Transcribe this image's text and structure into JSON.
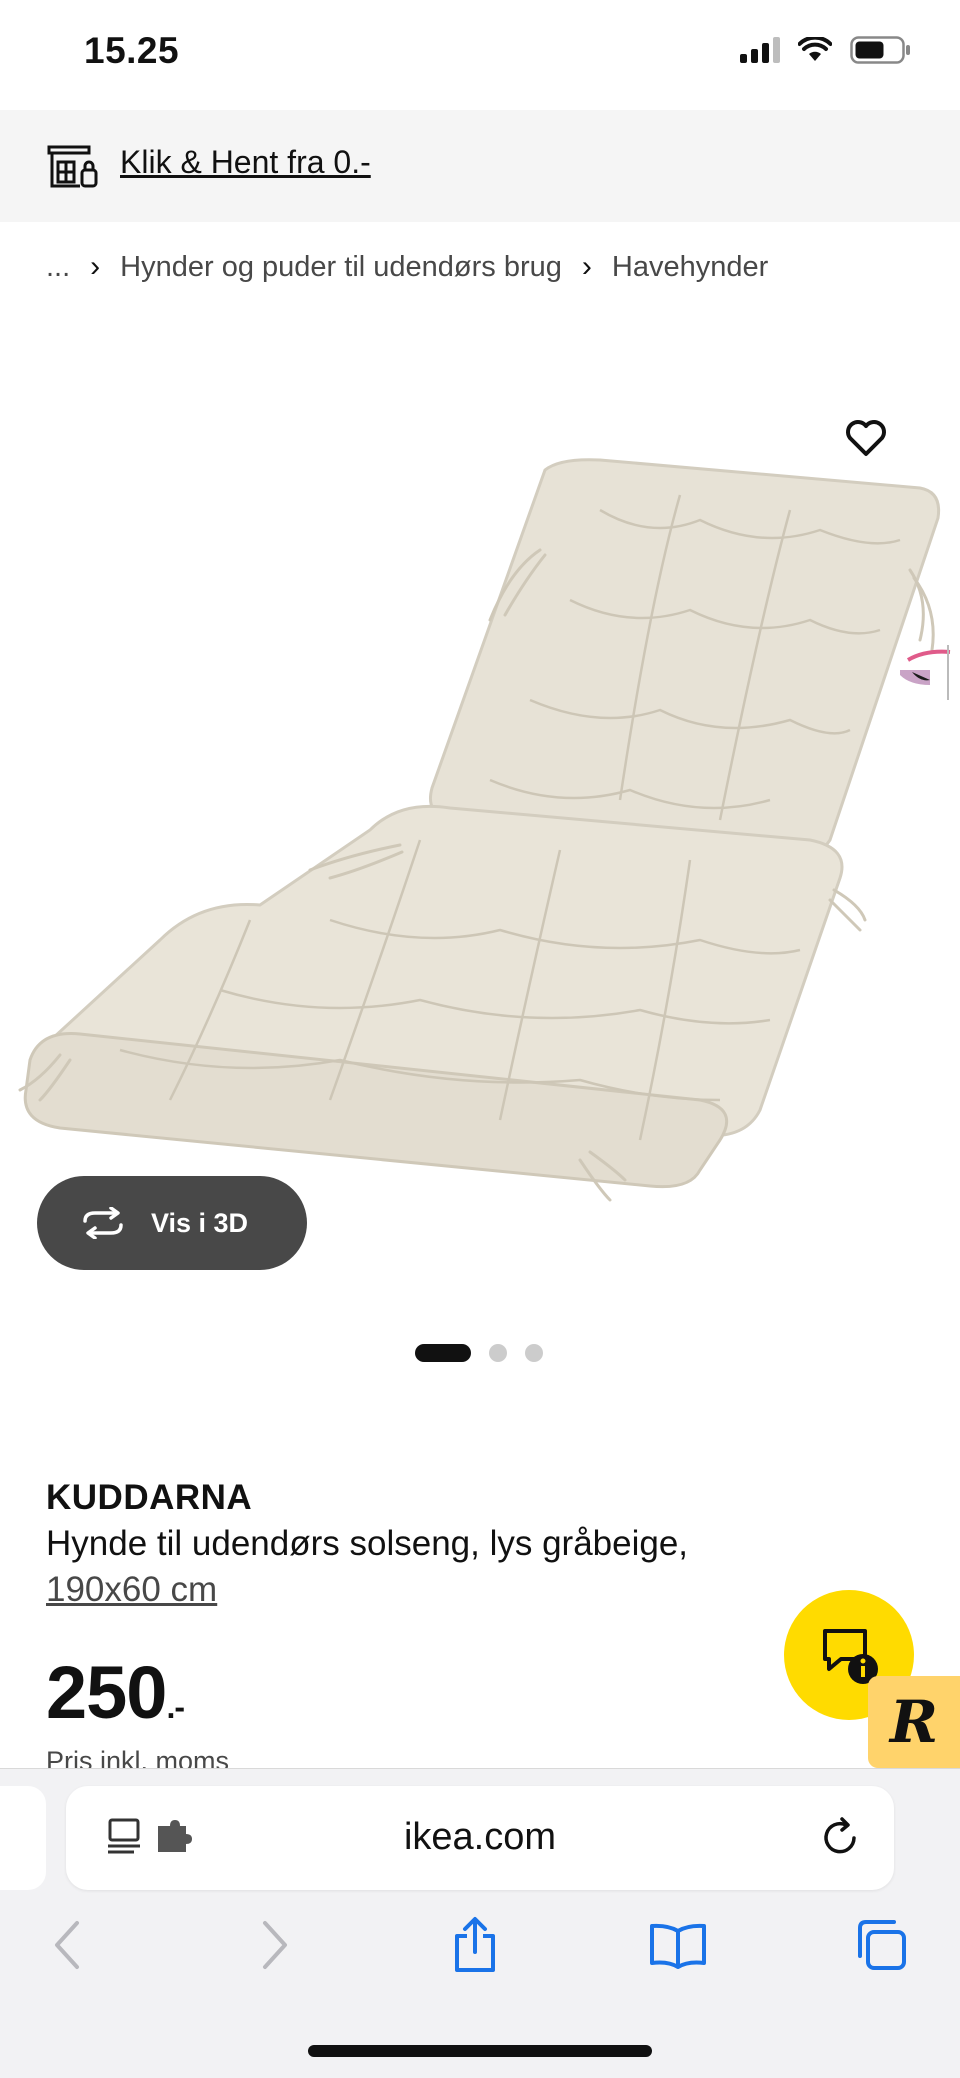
{
  "status_bar": {
    "time": "15.25"
  },
  "promo": {
    "icon": "store-pickup-icon",
    "link_text": "Klik & Hent fra 0.-"
  },
  "breadcrumb": {
    "items": [
      "...",
      "Hynder og puder til udendørs brug",
      "Havehynder"
    ],
    "separator_icon": "chevron-right-icon"
  },
  "gallery": {
    "favorite_icon": "heart-icon",
    "view_3d_label": "Vis i 3D",
    "view_3d_icon": "rotate-3d-icon",
    "slide_count": 3,
    "active_slide": 1
  },
  "product": {
    "name": "KUDDARNA",
    "description": "Hynde til udendørs solseng, lys gråbeige,",
    "size": "190x60 cm",
    "price": "250",
    "price_suffix": ".-",
    "price_note": "Pris inkl. moms"
  },
  "chat": {
    "icon": "chat-info-icon",
    "badge_letter": "R"
  },
  "browser": {
    "url": "ikea.com",
    "reader_icon": "reader-mode-icon",
    "extension_icon": "puzzle-extension-icon",
    "reload_icon": "reload-icon",
    "toolbar": [
      "back-icon",
      "forward-icon",
      "share-icon",
      "bookmarks-icon",
      "tabs-icon"
    ]
  },
  "colors": {
    "accent_yellow": "#ffdb00",
    "badge_yellow": "#ffd36b",
    "browser_blue": "#1a73e8",
    "dark_button": "#484848",
    "cushion": "#e6e1d4"
  }
}
